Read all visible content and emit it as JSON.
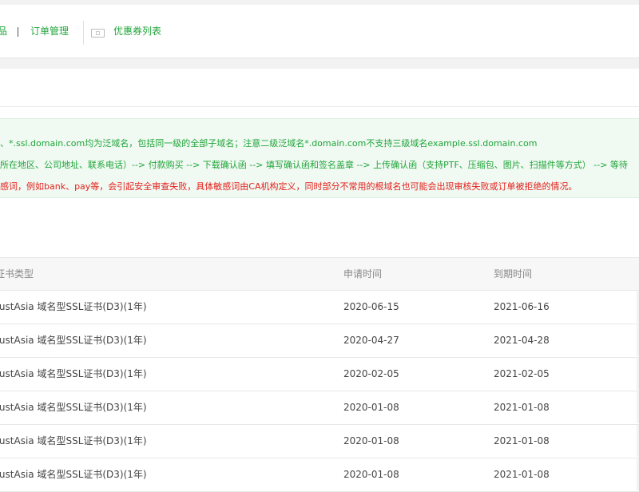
{
  "nav": {
    "items": [
      {
        "label": "品",
        "name": "nav-item-products"
      },
      {
        "label": "订单管理",
        "name": "nav-item-orders"
      },
      {
        "label": "优惠券列表",
        "name": "nav-item-coupons"
      }
    ],
    "separator": "|"
  },
  "notice": {
    "lines": [
      {
        "text": "、*.ssl.domain.com均为泛域名，包括同一级的全部子域名；注意二级泛域名*.domain.com不支持三级域名example.ssl.domain.com",
        "color": "#20a53a"
      },
      {
        "text": "所在地区、公司地址、联系电话）--> 付款购买 --> 下载确认函 --> 填写确认函和签名盖章 --> 上传确认函（支持PTF、压缩包、图片、扫描件等方式） --> 等待",
        "color": "#20a53a"
      },
      {
        "text": "感词，例如bank、pay等，会引起安全审查失败，具体敏感词由CA机构定义，同时部分不常用的根域名也可能会出现审核失败或订单被拒绝的情况。",
        "color": "#e5211d"
      }
    ]
  },
  "table": {
    "headers": {
      "type": "证书类型",
      "apply": "申请时间",
      "expire": "到期时间"
    },
    "rows": [
      {
        "type": "rustAsia 域名型SSL证书(D3)(1年)",
        "apply": "2020-06-15",
        "expire": "2021-06-16"
      },
      {
        "type": "rustAsia 域名型SSL证书(D3)(1年)",
        "apply": "2020-04-27",
        "expire": "2021-04-28"
      },
      {
        "type": "rustAsia 域名型SSL证书(D3)(1年)",
        "apply": "2020-02-05",
        "expire": "2021-02-05"
      },
      {
        "type": "rustAsia 域名型SSL证书(D3)(1年)",
        "apply": "2020-01-08",
        "expire": "2021-01-08"
      },
      {
        "type": "rustAsia 域名型SSL证书(D3)(1年)",
        "apply": "2020-01-08",
        "expire": "2021-01-08"
      },
      {
        "type": "rustAsia 域名型SSL证书(D3)(1年)",
        "apply": "2020-01-08",
        "expire": "2021-01-08"
      }
    ]
  },
  "colors": {
    "accent": "#20a53a",
    "warning": "#e5211d",
    "background": "#f2f2f2"
  },
  "icons": {
    "coupon": "coupon-icon"
  }
}
